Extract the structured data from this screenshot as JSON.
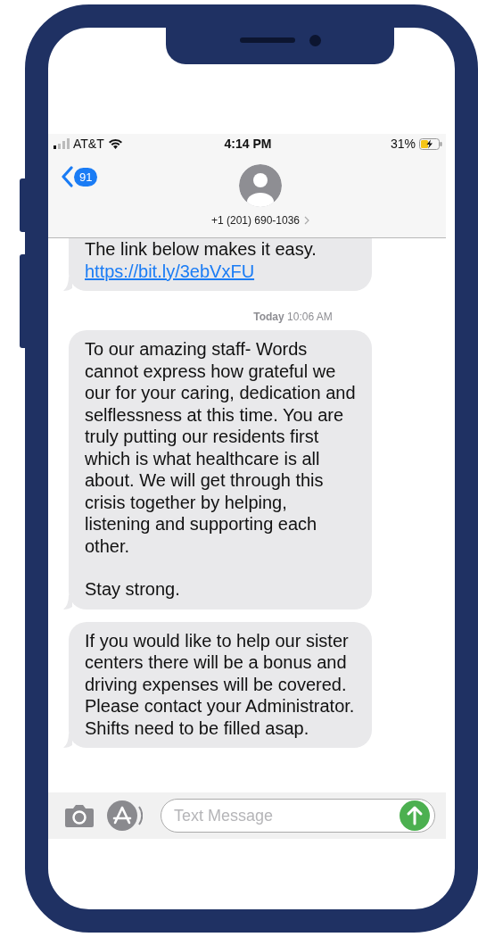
{
  "status_bar": {
    "carrier": "AT&T",
    "time": "4:14 PM",
    "battery": "31%",
    "charging": true
  },
  "header": {
    "unread_count": "91",
    "contact": "+1 (201) 690-1036"
  },
  "messages": [
    {
      "kind": "bubble",
      "paragraphs": [
        "The link below makes it easy."
      ],
      "link": "https://bit.ly/3ebVxFU",
      "cut_top": true
    },
    {
      "kind": "timestamp",
      "text": "**Today** 10:06 AM"
    },
    {
      "kind": "bubble",
      "paragraphs": [
        "To our amazing staff- Words cannot express how grateful we our for your caring, dedication and selflessness at this time. You are truly putting our residents first which is what healthcare is all about.  We will get through this crisis together by helping, listening and supporting each other.",
        "Stay strong."
      ]
    },
    {
      "kind": "bubble",
      "paragraphs": [
        "If you would like to help our sister centers there will be a bonus and driving expenses will be covered. Please contact your Administrator.  Shifts need to be filled asap."
      ]
    }
  ],
  "composer": {
    "placeholder": "Text Message"
  }
}
